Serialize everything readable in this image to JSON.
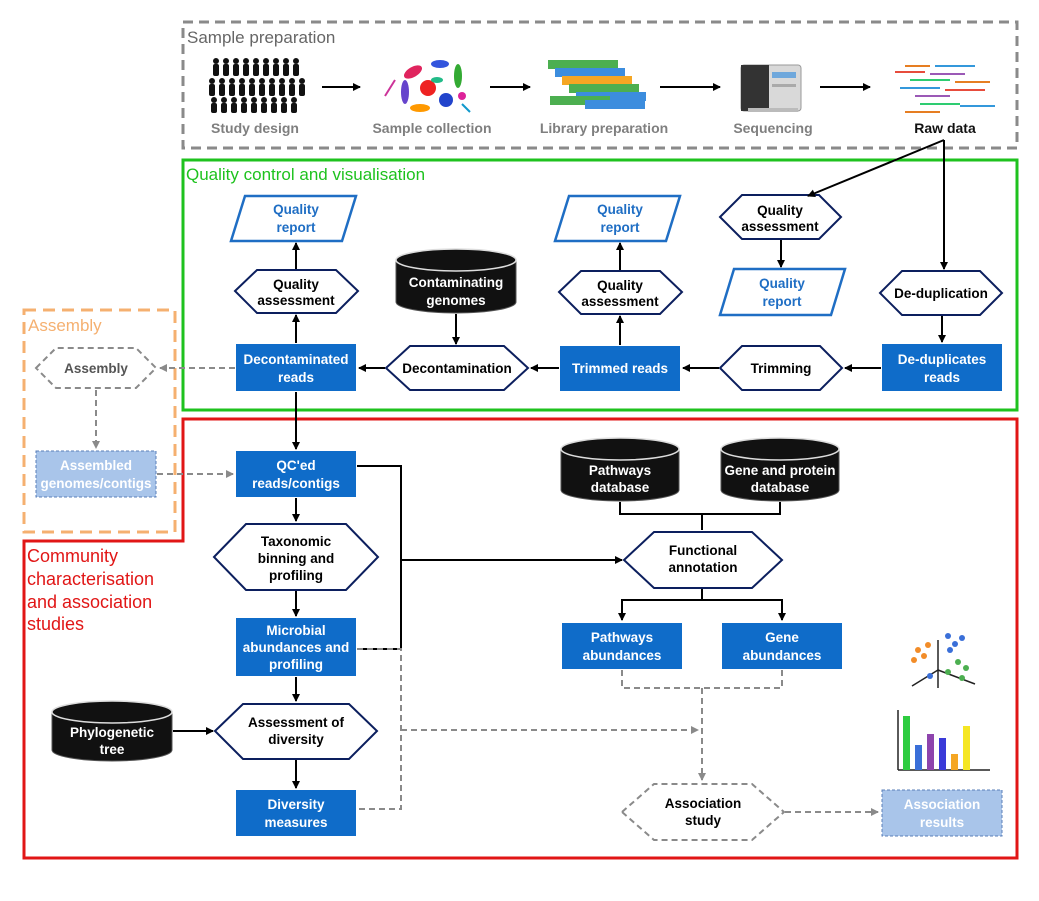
{
  "colors": {
    "blue_box": "#0f6cc9",
    "light_blue_box": "#a9c5ea",
    "report_text": "#1f6ec4",
    "hex_stroke": "#0c1f5e",
    "db_fill": "#111111",
    "gray_dash": "#8a8a8a",
    "qc_green": "#1ec21e",
    "community_red": "#e11616",
    "assembly_orange": "#f5b070"
  },
  "sections": {
    "sample_preparation": "Sample preparation",
    "quality_control": "Quality control and visualisation",
    "assembly": "Assembly",
    "community": [
      "Community",
      "characterisation",
      "and association",
      "studies"
    ]
  },
  "sample_steps": {
    "study_design": "Study design",
    "sample_collection": "Sample collection",
    "library_preparation": "Library preparation",
    "sequencing": "Sequencing",
    "raw_data": "Raw data"
  },
  "qc_nodes": {
    "quality_report_1": [
      "Quality",
      "report"
    ],
    "quality_assessment_1": [
      "Quality",
      "assessment"
    ],
    "contaminating_genomes": [
      "Contaminating",
      "genomes"
    ],
    "decontaminated_reads": [
      "Decontaminated",
      "reads"
    ],
    "decontamination": "Decontamination",
    "trimmed_reads": "Trimmed reads",
    "quality_report_2": [
      "Quality",
      "report"
    ],
    "quality_assessment_2": [
      "Quality",
      "assessment"
    ],
    "quality_assessment_3": [
      "Quality",
      "assessment"
    ],
    "quality_report_3": [
      "Quality",
      "report"
    ],
    "trimming": "Trimming",
    "deduplication": "De-duplication",
    "deduplicated_reads": [
      "De-duplicates",
      "reads"
    ]
  },
  "assembly_nodes": {
    "assembly": "Assembly",
    "assembled_genomes": [
      "Assembled",
      "genomes/contigs"
    ]
  },
  "community_nodes": {
    "qced_reads": [
      "QC'ed",
      "reads/contigs"
    ],
    "taxonomic_binning": [
      "Taxonomic",
      "binning and",
      "profiling"
    ],
    "microbial_abundances": [
      "Microbial",
      "abundances and",
      "profiling"
    ],
    "phylogenetic_tree": [
      "Phylogenetic",
      "tree"
    ],
    "assessment_diversity": [
      "Assessment of",
      "diversity"
    ],
    "diversity_measures": [
      "Diversity",
      "measures"
    ],
    "pathways_database": [
      "Pathways",
      "database"
    ],
    "gene_protein_database": [
      "Gene and protein",
      "database"
    ],
    "functional_annotation": [
      "Functional",
      "annotation"
    ],
    "pathways_abundances": [
      "Pathways",
      "abundances"
    ],
    "gene_abundances": [
      "Gene",
      "abundances"
    ],
    "association_study": [
      "Association",
      "study"
    ],
    "association_results": [
      "Association",
      "results"
    ]
  }
}
